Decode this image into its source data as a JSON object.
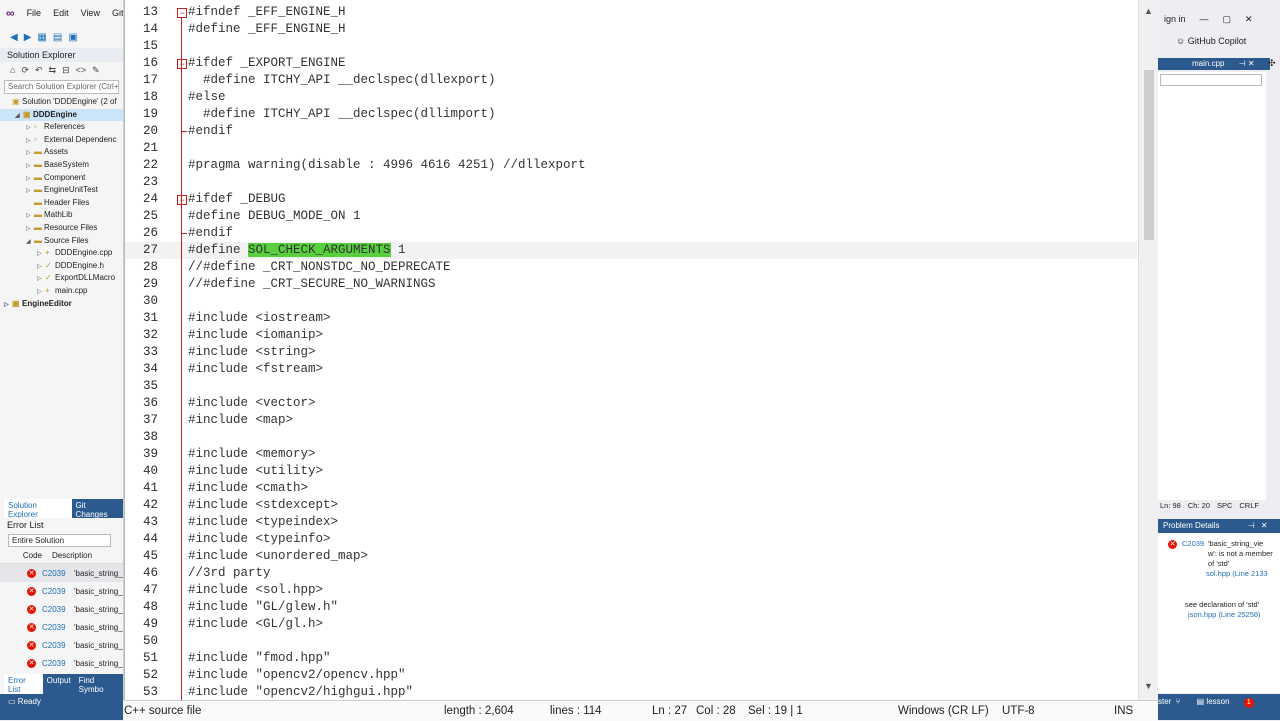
{
  "vs_left": {
    "menu": [
      "File",
      "Edit",
      "View",
      "Git"
    ],
    "solution_explorer_title": "Solution Explorer",
    "search_placeholder": "Search Solution Explorer (Ctrl+;)",
    "tree": [
      {
        "label": "Solution 'DDDEngine' (2 of",
        "level": 0,
        "bold": false,
        "arrow": "",
        "icon": "▣"
      },
      {
        "label": "DDDEngine",
        "level": 1,
        "bold": true,
        "arrow": "◢",
        "icon": "▣",
        "selected": true
      },
      {
        "label": "References",
        "level": 2,
        "bold": false,
        "arrow": "▷",
        "icon": "▫"
      },
      {
        "label": "External Dependenc",
        "level": 2,
        "bold": false,
        "arrow": "▷",
        "icon": "▫"
      },
      {
        "label": "Assets",
        "level": 2,
        "bold": false,
        "arrow": "▷",
        "icon": "▬"
      },
      {
        "label": "BaseSystem",
        "level": 2,
        "bold": false,
        "arrow": "▷",
        "icon": "▬"
      },
      {
        "label": "Component",
        "level": 2,
        "bold": false,
        "arrow": "▷",
        "icon": "▬"
      },
      {
        "label": "EngineUnitTest",
        "level": 2,
        "bold": false,
        "arrow": "▷",
        "icon": "▬"
      },
      {
        "label": "Header Files",
        "level": 2,
        "bold": false,
        "arrow": "",
        "icon": "▬"
      },
      {
        "label": "MathLib",
        "level": 2,
        "bold": false,
        "arrow": "▷",
        "icon": "▬"
      },
      {
        "label": "Resource Files",
        "level": 2,
        "bold": false,
        "arrow": "▷",
        "icon": "▬"
      },
      {
        "label": "Source Files",
        "level": 2,
        "bold": false,
        "arrow": "◢",
        "icon": "▬"
      },
      {
        "label": "DDDEngine.cpp",
        "level": 3,
        "bold": false,
        "arrow": "▷",
        "icon": "+"
      },
      {
        "label": "DDDEngine.h",
        "level": 3,
        "bold": false,
        "arrow": "▷",
        "icon": "✓"
      },
      {
        "label": "ExportDLLMacro",
        "level": 3,
        "bold": false,
        "arrow": "▷",
        "icon": "✓"
      },
      {
        "label": "main.cpp",
        "level": 3,
        "bold": false,
        "arrow": "▷",
        "icon": "+"
      },
      {
        "label": "EngineEditor",
        "level": 0,
        "bold": true,
        "arrow": "▷",
        "icon": "▣"
      }
    ],
    "bottom_tabs": [
      "Solution Explorer",
      "Git Changes"
    ],
    "error_list": {
      "title": "Error List",
      "filter": "Entire Solution",
      "col_code": "Code",
      "col_desc": "Description",
      "rows": [
        {
          "code": "C2039",
          "desc": "'basic_string_"
        },
        {
          "code": "C2039",
          "desc": "'basic_string_"
        },
        {
          "code": "C2039",
          "desc": "'basic_string_"
        },
        {
          "code": "C2039",
          "desc": "'basic_string_"
        },
        {
          "code": "C2039",
          "desc": "'basic_string_"
        },
        {
          "code": "C2039",
          "desc": "'basic_string_"
        }
      ],
      "tabs": [
        "Error List",
        "Output",
        "Find Symbo"
      ]
    },
    "status_ready": "Ready"
  },
  "editor": {
    "lines": [
      {
        "n": "13",
        "text": "#ifndef _EFF_ENGINE_H",
        "fold": "start"
      },
      {
        "n": "14",
        "text": "#define _EFF_ENGINE_H"
      },
      {
        "n": "15",
        "text": ""
      },
      {
        "n": "16",
        "text": "#ifdef _EXPORT_ENGINE",
        "fold": "start"
      },
      {
        "n": "17",
        "text": "  #define ITCHY_API __declspec(dllexport)"
      },
      {
        "n": "18",
        "text": "#else"
      },
      {
        "n": "19",
        "text": "  #define ITCHY_API __declspec(dllimport)"
      },
      {
        "n": "20",
        "text": "#endif",
        "fold": "end"
      },
      {
        "n": "21",
        "text": ""
      },
      {
        "n": "22",
        "text": "#pragma warning(disable : 4996 4616 4251) //dllexport"
      },
      {
        "n": "23",
        "text": ""
      },
      {
        "n": "24",
        "text": "#ifdef _DEBUG",
        "fold": "start"
      },
      {
        "n": "25",
        "text": "#define DEBUG_MODE_ON 1"
      },
      {
        "n": "26",
        "text": "#endif",
        "fold": "end"
      },
      {
        "n": "27",
        "text_before": "#define ",
        "text_hl": "SOL_CHECK_ARGUMENTS",
        "text_after": " 1",
        "current": true
      },
      {
        "n": "28",
        "text": "//#define _CRT_NONSTDC_NO_DEPRECATE"
      },
      {
        "n": "29",
        "text": "//#define _CRT_SECURE_NO_WARNINGS"
      },
      {
        "n": "30",
        "text": ""
      },
      {
        "n": "31",
        "text": "#include <iostream>"
      },
      {
        "n": "32",
        "text": "#include <iomanip>"
      },
      {
        "n": "33",
        "text": "#include <string>"
      },
      {
        "n": "34",
        "text": "#include <fstream>"
      },
      {
        "n": "35",
        "text": ""
      },
      {
        "n": "36",
        "text": "#include <vector>"
      },
      {
        "n": "37",
        "text": "#include <map>"
      },
      {
        "n": "38",
        "text": ""
      },
      {
        "n": "39",
        "text": "#include <memory>"
      },
      {
        "n": "40",
        "text": "#include <utility>"
      },
      {
        "n": "41",
        "text": "#include <cmath>"
      },
      {
        "n": "42",
        "text": "#include <stdexcept>"
      },
      {
        "n": "43",
        "text": "#include <typeindex>"
      },
      {
        "n": "44",
        "text": "#include <typeinfo>"
      },
      {
        "n": "45",
        "text": "#include <unordered_map>"
      },
      {
        "n": "46",
        "text": "//3rd party"
      },
      {
        "n": "47",
        "text": "#include <sol.hpp>"
      },
      {
        "n": "48",
        "text": "#include \"GL/glew.h\""
      },
      {
        "n": "49",
        "text": "#include <GL/gl.h>"
      },
      {
        "n": "50",
        "text": ""
      },
      {
        "n": "51",
        "text": "#include \"fmod.hpp\""
      },
      {
        "n": "52",
        "text": "#include \"opencv2/opencv.hpp\""
      },
      {
        "n": "53",
        "text": "#include \"opencv2/highgui.hpp\""
      }
    ]
  },
  "statusbar": {
    "file_type": "C++ source file",
    "length": "length : 2,604",
    "lines": "lines : 114",
    "ln": "Ln : 27",
    "col": "Col : 28",
    "sel": "Sel : 19 | 1",
    "eol": "Windows (CR LF)",
    "encoding": "UTF-8",
    "mode": "INS"
  },
  "vs_right": {
    "sign_in": "ign in",
    "copilot": "GitHub Copilot",
    "tab": "main.cpp",
    "status": [
      "Ln: 98",
      "Ch: 20",
      "SPC",
      "CRLF"
    ],
    "problem_details_title": "Problem Details",
    "problem_code": "C2039",
    "problem_text": "'basic_string_vie w': is not a member of 'std'",
    "problem_link": "sol.hpp (Line 2133",
    "see_decl": "see declaration of 'std'",
    "see_link": "json.hpp (Line 25258)",
    "bottom_branch": "ster",
    "bottom_repo": "lesson"
  },
  "colors": {
    "highlight": "#58cf3c",
    "fold_marker": "#c02020",
    "accent_blue": "#2d5a8e",
    "error_red": "#e51400"
  }
}
